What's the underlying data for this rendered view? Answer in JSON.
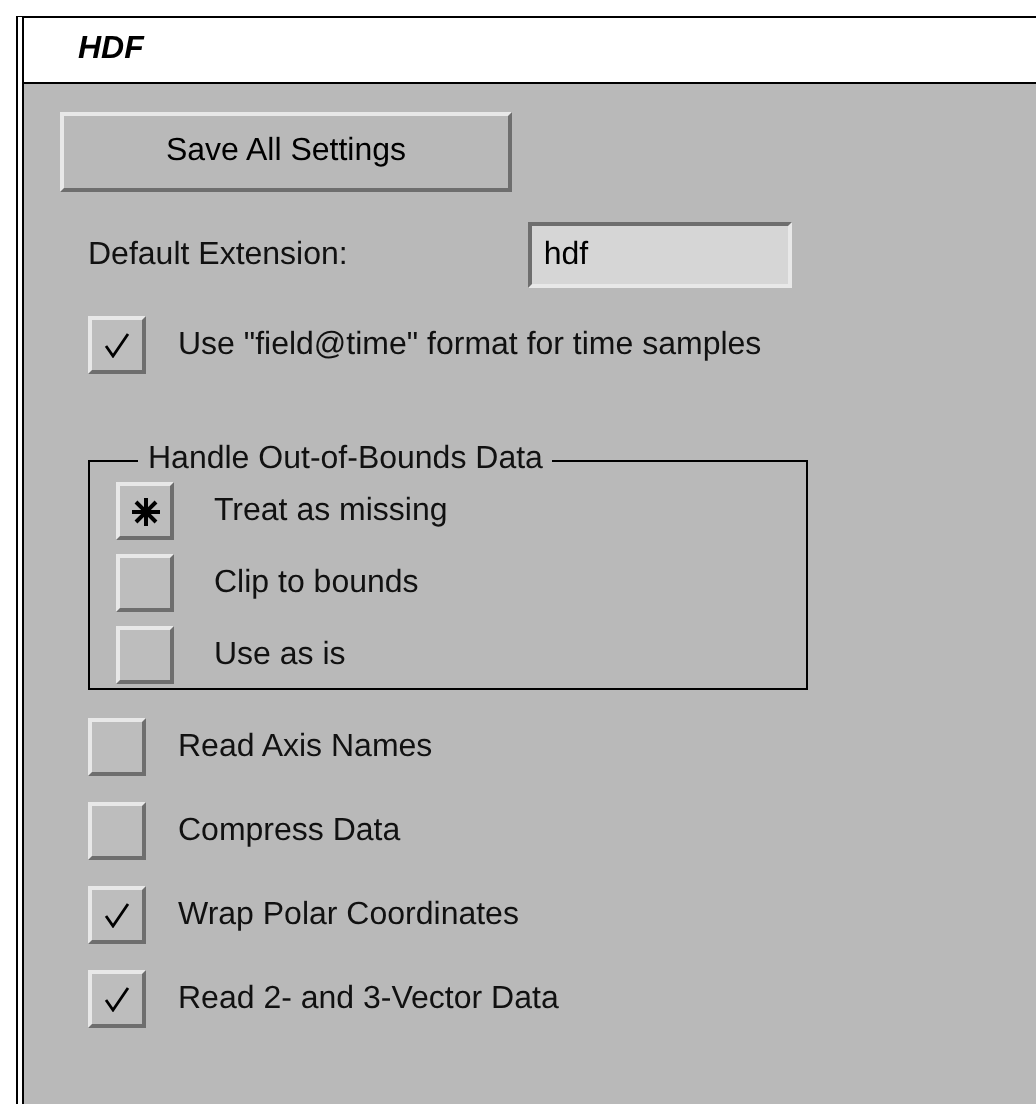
{
  "window": {
    "title": "HDF"
  },
  "save_button": {
    "label": "Save All Settings"
  },
  "default_extension": {
    "label": "Default Extension:",
    "value": "hdf"
  },
  "time_format": {
    "label": "Use \"field@time\" format for time samples",
    "checked": true
  },
  "out_of_bounds": {
    "title": "Handle Out-of-Bounds Data",
    "options": [
      {
        "label": "Treat as missing",
        "selected": true
      },
      {
        "label": "Clip to bounds",
        "selected": false
      },
      {
        "label": "Use as is",
        "selected": false
      }
    ]
  },
  "options": [
    {
      "label": "Read Axis Names",
      "checked": false
    },
    {
      "label": "Compress Data",
      "checked": false
    },
    {
      "label": "Wrap Polar Coordinates",
      "checked": true
    },
    {
      "label": "Read 2- and 3-Vector Data",
      "checked": true
    }
  ]
}
